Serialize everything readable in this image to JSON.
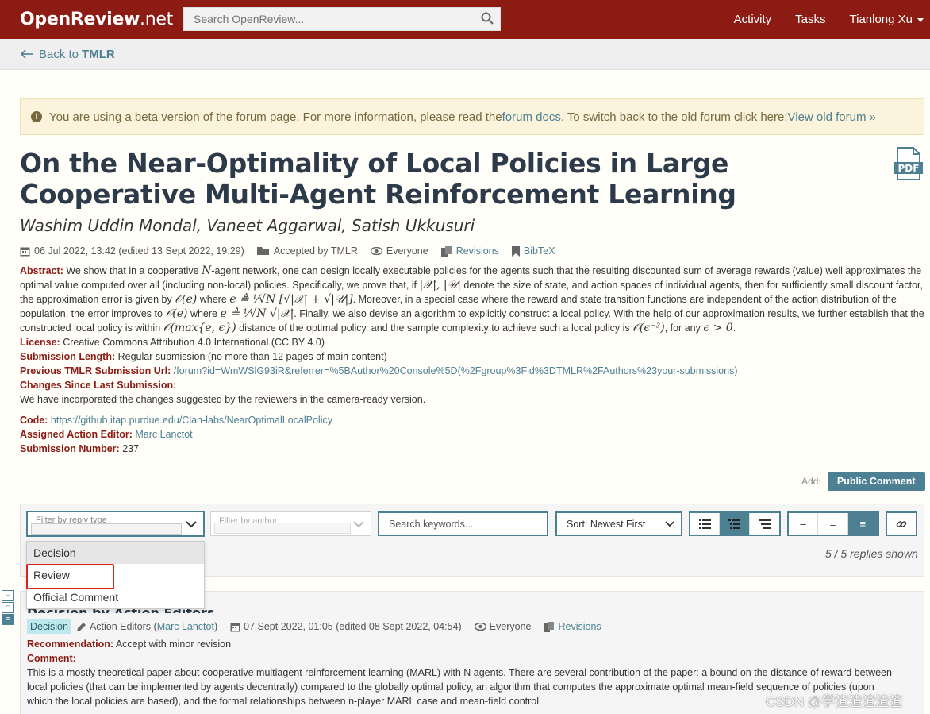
{
  "nav": {
    "brand_bold": "OpenReview",
    "brand_light": ".net",
    "search_placeholder": "Search OpenReview...",
    "activity": "Activity",
    "tasks": "Tasks",
    "user": "Tianlong Xu"
  },
  "back": {
    "prefix": "Back to",
    "venue": "TMLR"
  },
  "beta": {
    "text1": "You are using a beta version of the forum page. For more information, please read the ",
    "link1": "forum docs",
    "text2": ". To switch back to the old forum click here: ",
    "link2": "View old forum »"
  },
  "paper": {
    "title": "On the Near-Optimality of Local Policies in Large Cooperative Multi-Agent Reinforcement Learning",
    "authors": "Washim Uddin Mondal, Vaneet Aggarwal, Satish Ukkusuri",
    "date": "06 Jul 2022, 13:42 (edited 13 Sept 2022, 19:29)",
    "venue": "Accepted by TMLR",
    "readers": "Everyone",
    "revisions": "Revisions",
    "bibtex": "BibTeX",
    "pdf_label": "PDF"
  },
  "abstract": {
    "label": "Abstract:",
    "p1": "We show that in a cooperative ",
    "N": "N",
    "p2": "-agent network, one can design locally executable policies for the agents such that the resulting discounted sum of average rewards (value) well approximates the optimal value computed over all (including non-local) policies. Specifically, we prove that, if ",
    "XU": "|𝒳|, |𝒰|",
    "p3": " denote the size of state, and action spaces of individual agents, then for sufficiently small discount factor, the approximation error is given by ",
    "Oe": "𝒪(e)",
    "p4": " where ",
    "e1": "e ≜ ¹⁄√N [√|𝒳| + √|𝒰|]",
    "p5": ". Moreover, in a special case where the reward and state transition functions are independent of the action distribution of the population, the error improves to ",
    "Oe2": "𝒪(e)",
    "p6": " where ",
    "e2": "e ≜ ¹⁄√N √|𝒳|",
    "p7": ". Finally, we also devise an algorithm to explicitly construct a local policy. With the help of our approximation results, we further establish that the constructed local policy is within ",
    "Omax": "𝒪(max{e, ϵ})",
    "p8": " distance of the optimal policy, and the sample complexity to achieve such a local policy is ",
    "Oeps": "𝒪(ϵ⁻³)",
    "p9": ", for any ",
    "epsgt": "ϵ > 0",
    "p10": "."
  },
  "license": {
    "label": "License:",
    "value": "Creative Commons Attribution 4.0 International (CC BY 4.0)"
  },
  "length": {
    "label": "Submission Length:",
    "value": "Regular submission (no more than 12 pages of main content)"
  },
  "prev": {
    "label": "Previous TMLR Submission Url:",
    "value": "/forum?id=WmWSlG93iR&referrer=%5BAuthor%20Console%5D(%2Fgroup%3Fid%3DTMLR%2FAuthors%23your-submissions)"
  },
  "changes": {
    "label": "Changes Since Last Submission:",
    "value": "We have incorporated the changes suggested by the reviewers in the camera-ready version."
  },
  "code": {
    "label": "Code:",
    "value": "https://github.itap.purdue.edu/Clan-labs/NearOptimalLocalPolicy"
  },
  "editor": {
    "label": "Assigned Action Editor:",
    "value": "Marc Lanctot"
  },
  "number": {
    "label": "Submission Number:",
    "value": "237"
  },
  "add": {
    "label": "Add:",
    "button": "Public Comment"
  },
  "filters": {
    "reply_type_placeholder": "Filter by reply type",
    "author_placeholder": "Filter by author",
    "keywords_placeholder": "Search keywords...",
    "sort": "Sort: Newest First",
    "shown": "5 / 5 replies shown",
    "dropdown": [
      "Decision",
      "Review",
      "Official Comment"
    ]
  },
  "note": {
    "title": "Decision by Action Editors",
    "badge": "Decision",
    "signature_prefix": "Action Editors (",
    "signature_link": "Marc Lanctot",
    "signature_suffix": ")",
    "date": "07 Sept 2022, 01:05 (edited 08 Sept 2022, 04:54)",
    "readers": "Everyone",
    "revisions": "Revisions",
    "rec_label": "Recommendation:",
    "rec_value": "Accept with minor revision",
    "comment_label": "Comment:",
    "comment_value": "This is a mostly theoretical paper about cooperative multiagent reinforcement learning (MARL) with N agents. There are several contribution of the paper: a bound on the distance of reward between local policies (that can be implemented by agents decentrally) compared to the globally optimal policy, an algorithm that computes the approximate optimal mean-field sequence of policies (upon which the local policies are based), and the formal relationships between n-player MARL case and mean-field control."
  },
  "watermark": "CSDN @学渣渣渣渣渣",
  "colors": {
    "nav": "#8c1b13",
    "accent": "#4d8093",
    "highlight": "#e0231a"
  }
}
